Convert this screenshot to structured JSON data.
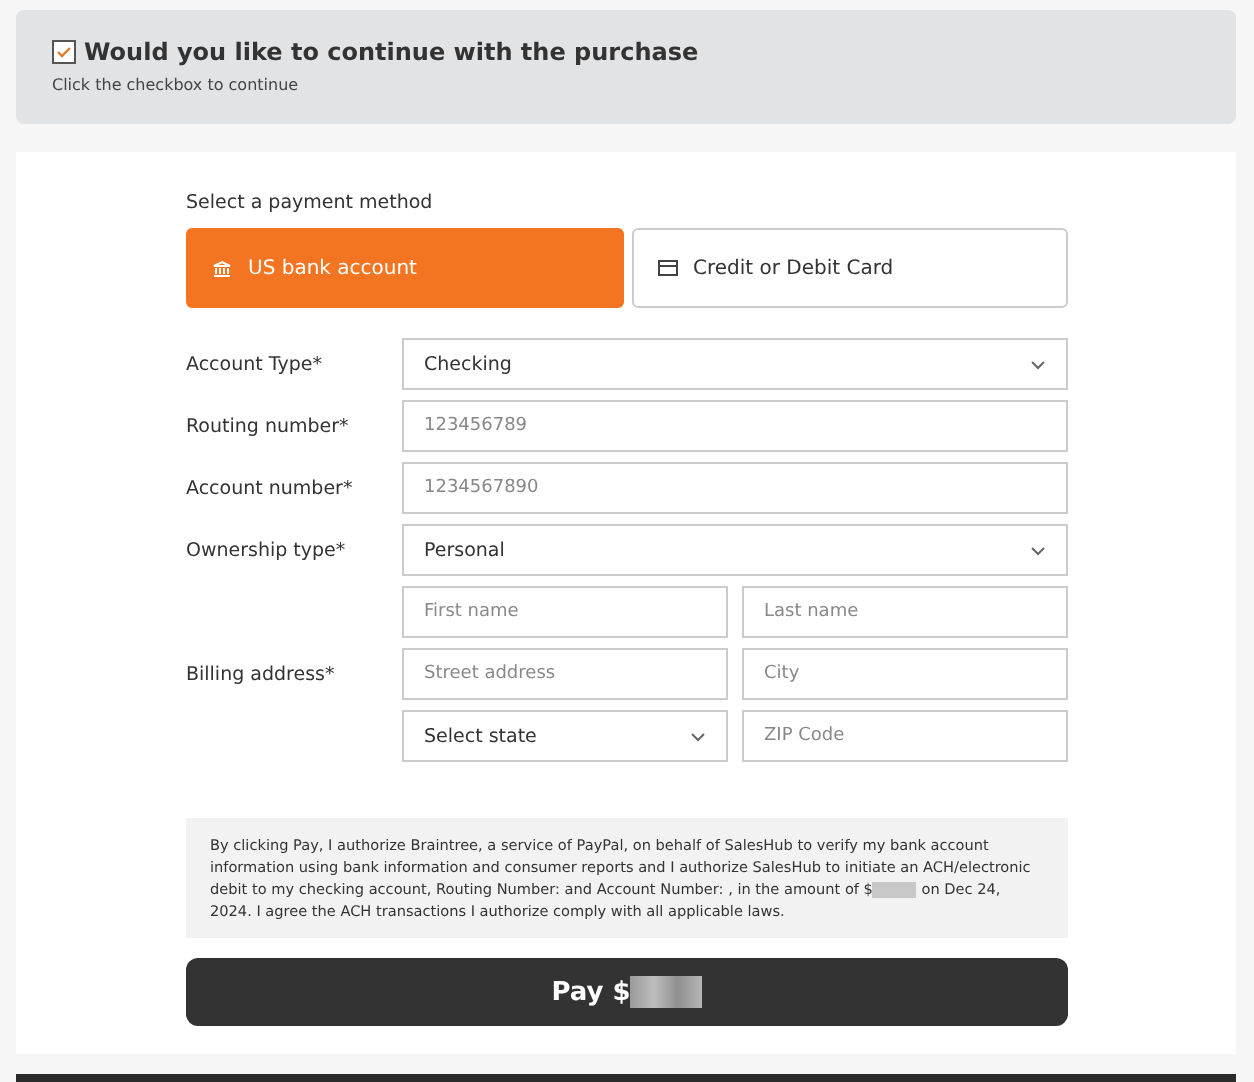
{
  "confirm": {
    "title": "Would you like to continue with the purchase",
    "hint": "Click the checkbox to continue",
    "checked": true
  },
  "payment": {
    "heading": "Select a payment method",
    "methods": [
      {
        "label": "US bank account",
        "kind": "bank",
        "selected": true
      },
      {
        "label": "Credit or Debit Card",
        "kind": "card",
        "selected": false
      }
    ]
  },
  "form": [
    {
      "label": "Account Type*",
      "fields": [
        {
          "kind": "select",
          "value": "Checking"
        }
      ]
    },
    {
      "label": "Routing number*",
      "fields": [
        {
          "kind": "input",
          "placeholder": "123456789"
        }
      ]
    },
    {
      "label": "Account number*",
      "fields": [
        {
          "kind": "input",
          "placeholder": "1234567890"
        }
      ]
    },
    {
      "label": "Ownership type*",
      "fields": [
        {
          "kind": "select",
          "value": "Personal"
        }
      ]
    }
  ],
  "billing": {
    "label": "Billing address*",
    "rows": [
      [
        {
          "kind": "input",
          "placeholder": "First name"
        },
        {
          "kind": "input",
          "placeholder": "Last name"
        }
      ],
      [
        {
          "kind": "input",
          "placeholder": "Street address"
        },
        {
          "kind": "input",
          "placeholder": "City"
        }
      ],
      [
        {
          "kind": "select",
          "value": "Select state"
        },
        {
          "kind": "input",
          "placeholder": "ZIP Code"
        }
      ]
    ]
  },
  "disclaimer": {
    "before": "By clicking Pay, I authorize Braintree, a service of PayPal, on behalf of SalesHub to verify my bank account information using bank information and consumer reports and I authorize SalesHub to initiate an ACH/electronic debit to my checking account, Routing Number: and Account Number: , in the amount of $",
    "after": " on Dec 24, 2024. I agree the ACH transactions I authorize comply with all applicable laws."
  },
  "pay_button": "Pay $"
}
